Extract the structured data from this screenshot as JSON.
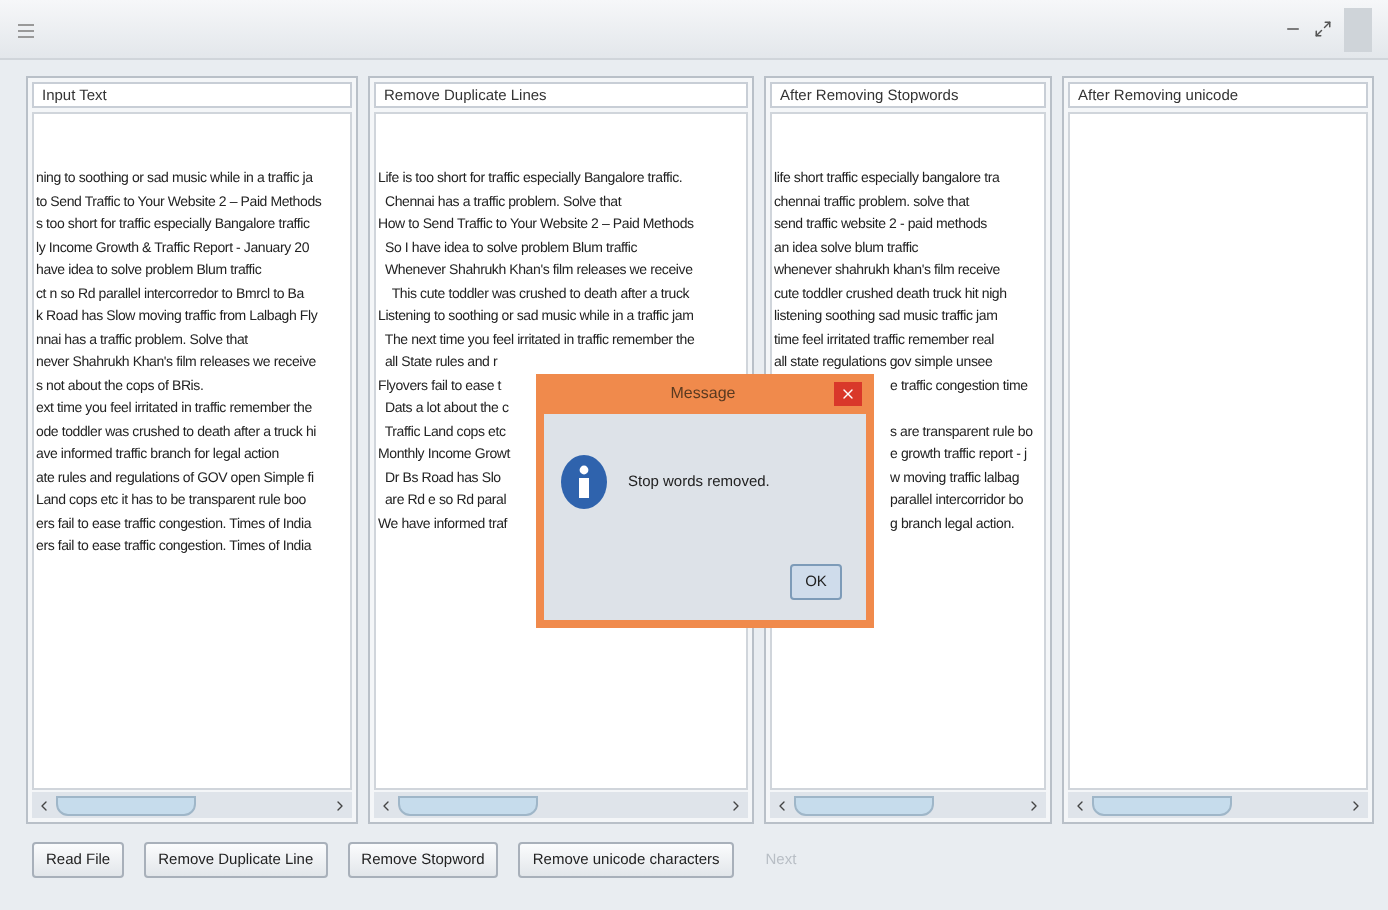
{
  "panels": [
    {
      "title": "Input Text",
      "lines": [
        "ning to soothing or sad music while in a traffic ja",
        "to Send Traffic to Your Website 2 – Paid Methods",
        "s too short for traffic especially Bangalore traffic",
        "ly Income Growth & Traffic Report - January 20",
        "have idea to solve problem Blum traffic",
        "ct n so Rd parallel intercorredor to Bmrcl to Ba",
        "k Road has Slow moving traffic from Lalbagh Fly",
        "nnai has a traffic problem. Solve that",
        "never Shahrukh Khan's film releases we receive",
        "s not about the cops of BRis.",
        "ext time you feel irritated in traffic remember the",
        "ode toddler was crushed to death after a truck hi",
        "ave informed traffic branch for legal action",
        "ate rules and regulations of GOV open Simple fi",
        "Land cops etc it has to be transparent rule boo",
        "ers fail to ease traffic congestion. Times of India",
        "ers fail to ease traffic congestion. Times of India"
      ]
    },
    {
      "title": "Remove Duplicate Lines",
      "lines": [
        "Life is too short for traffic especially Bangalore traffic.",
        "  Chennai has a traffic problem. Solve that",
        "How to Send Traffic to Your Website 2 – Paid Methods",
        "  So I have idea to solve problem Blum traffic",
        "  Whenever Shahrukh Khan's film releases we receive",
        "    This cute toddler was crushed to death after a truck",
        "Listening to soothing or sad music while in a traffic jam",
        "  The next time you feel irritated in traffic remember the",
        "  all State rules and r",
        "Flyovers fail to ease t",
        "  Dats a lot about the c",
        "  Traffic Land cops etc",
        "Monthly Income Growt",
        "  Dr Bs Road has Slo",
        "  are Rd e so Rd paral",
        "We have informed traf"
      ]
    },
    {
      "title": "After Removing Stopwords",
      "lines": [
        "life short traffic especially bangalore tra",
        "chennai traffic problem. solve that",
        "send traffic website 2 - paid methods",
        "an idea solve blum traffic",
        "whenever shahrukh khan's film receive",
        "cute toddler crushed death truck hit nigh",
        "listening soothing sad music traffic jam",
        "time feel irritated traffic remember real",
        "all state regulations gov simple unsee",
        {
          "text": "e traffic congestion time",
          "covered_left": true
        },
        {
          "text": "s are transparent rule bo",
          "covered_left": true,
          "gap_before": true
        },
        {
          "text": "e growth traffic report - j",
          "covered_left": true
        },
        {
          "text": "w moving traffic lalbag",
          "covered_left": true
        },
        {
          "text": "parallel intercorridor bo",
          "covered_left": true
        },
        {
          "text": "g branch legal action.",
          "covered_left": true
        }
      ]
    },
    {
      "title": "After Removing unicode"
    }
  ],
  "buttons": [
    {
      "label": "Read File",
      "disabled": false
    },
    {
      "label": "Remove Duplicate Line",
      "disabled": false
    },
    {
      "label": "Remove Stopword",
      "disabled": false
    },
    {
      "label": "Remove unicode characters",
      "disabled": false
    },
    {
      "label": "Next",
      "disabled": true
    }
  ],
  "dialog": {
    "title": "Message",
    "message": "Stop words removed.",
    "button": "OK"
  }
}
